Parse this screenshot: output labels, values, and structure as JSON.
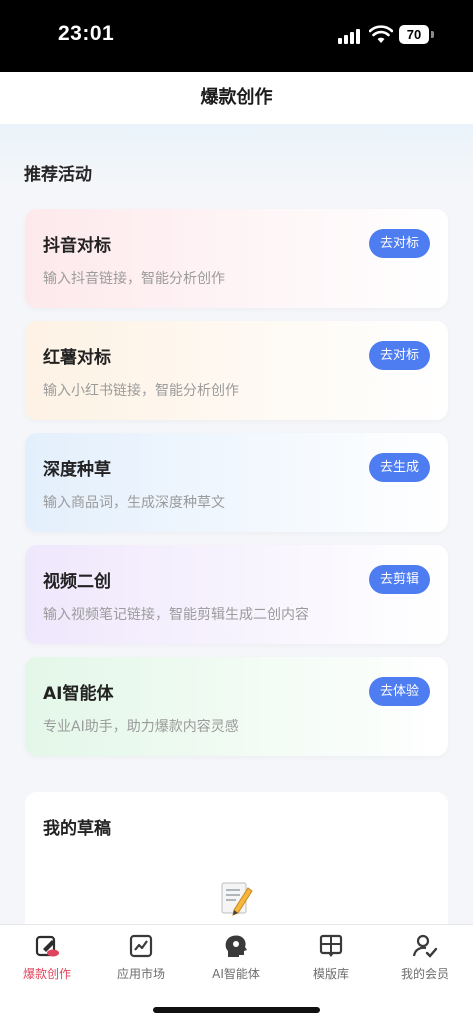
{
  "status_bar": {
    "time": "23:01",
    "battery": "70"
  },
  "nav": {
    "title": "爆款创作"
  },
  "section": {
    "title": "推荐活动"
  },
  "cards": [
    {
      "title": "抖音对标",
      "desc": "输入抖音链接，智能分析创作",
      "button": "去对标",
      "bg": "#fdeff1"
    },
    {
      "title": "红薯对标",
      "desc": "输入小红书链接，智能分析创作",
      "button": "去对标",
      "bg": "#fdf5ea"
    },
    {
      "title": "深度种草",
      "desc": "输入商品词，生成深度种草文",
      "button": "去生成",
      "bg": "#eaf3fd"
    },
    {
      "title": "视频二创",
      "desc": "输入视频笔记链接，智能剪辑生成二创内容",
      "button": "去剪辑",
      "bg": "#f3edfd"
    },
    {
      "title": "AI智能体",
      "desc": "专业AI助手，助力爆款内容灵感",
      "button": "去体验",
      "bg": "#ebf9ee"
    }
  ],
  "drafts": {
    "title": "我的草稿",
    "icon": "memo-icon"
  },
  "tabs": [
    {
      "label": "爆款创作",
      "icon": "create-icon",
      "active": true
    },
    {
      "label": "应用市场",
      "icon": "chart-icon",
      "active": false
    },
    {
      "label": "AI智能体",
      "icon": "ai-head-icon",
      "active": false
    },
    {
      "label": "模版库",
      "icon": "template-icon",
      "active": false
    },
    {
      "label": "我的会员",
      "icon": "member-icon",
      "active": false
    }
  ],
  "colors": {
    "accent": "#4e7df1",
    "active_tab": "#e0445c"
  }
}
